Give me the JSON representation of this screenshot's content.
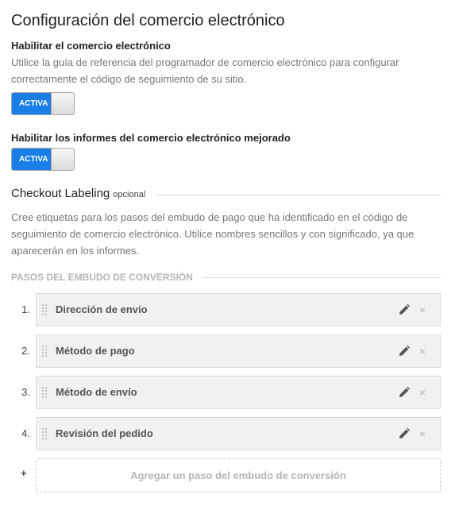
{
  "page": {
    "title": "Configuración del comercio electrónico"
  },
  "ecommerce": {
    "label": "Habilitar el comercio electrónico",
    "help": "Utilice la guía de referencia del programador de comercio electrónico para configurar correctamente el código de seguimiento de su sitio.",
    "toggle_text": "ACTIVA",
    "enabled": true
  },
  "enhanced": {
    "label": "Habilitar los informes del comercio electrónico mejorado",
    "toggle_text": "ACTIVA",
    "enabled": true
  },
  "checkout": {
    "title": "Checkout Labeling",
    "optional": "opcional",
    "help": "Cree etiquetas para los pasos del embudo de pago que ha identificado en el código de seguimiento de comercio electrónico. Utilice nombres sencillos y con significado, ya que aparecerán en los informes."
  },
  "funnel": {
    "heading": "PASOS DEL EMBUDO DE CONVERSIÓN",
    "steps": [
      {
        "number": "1.",
        "label": "Dirección de envío"
      },
      {
        "number": "2.",
        "label": "Método de pago"
      },
      {
        "number": "3.",
        "label": "Método de envío"
      },
      {
        "number": "4.",
        "label": "Revisión del pedido"
      }
    ],
    "edit_icon": "pencil-icon",
    "delete_icon": "close-icon",
    "delete_glyph": "×",
    "add_symbol": "+",
    "add_label": "Agregar un paso del embudo de conversión"
  },
  "colors": {
    "toggle_on": "#1a7ee6",
    "muted_text": "#777777",
    "step_bg": "#f1f1f1"
  }
}
